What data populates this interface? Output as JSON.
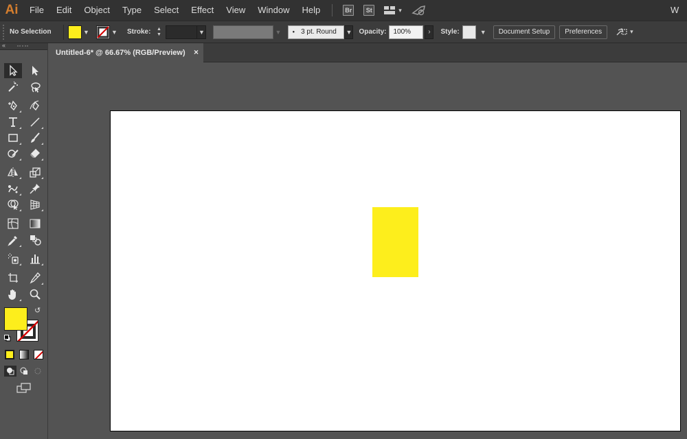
{
  "app": {
    "logo": "Ai",
    "workspace_label": "W"
  },
  "menu": [
    "File",
    "Edit",
    "Object",
    "Type",
    "Select",
    "Effect",
    "View",
    "Window",
    "Help"
  ],
  "app_buttons": [
    "Br",
    "St"
  ],
  "control_bar": {
    "selection_label": "No Selection",
    "stroke_label": "Stroke:",
    "stroke_weight": "",
    "brush_label": "3 pt. Round",
    "opacity_label": "Opacity:",
    "opacity_value": "100%",
    "style_label": "Style:",
    "document_setup": "Document Setup",
    "preferences": "Preferences"
  },
  "document": {
    "tab_title": "Untitled-6* @ 66.67% (RGB/Preview)",
    "close_glyph": "×"
  },
  "colors": {
    "fill": "#fdee1c",
    "rect_fill": "#fdee1c",
    "menu_bg": "#323232",
    "panel_bg": "#535353",
    "artboard": "#ffffff",
    "logo": "#d57e2e"
  },
  "tools": [
    [
      "selection-tool",
      "direct-selection-tool"
    ],
    [
      "magic-wand-tool",
      "lasso-tool"
    ],
    [
      "pen-tool",
      "curvature-tool"
    ],
    [
      "type-tool",
      "line-segment-tool"
    ],
    [
      "rectangle-tool",
      "paintbrush-tool"
    ],
    [
      "shaper-tool",
      "eraser-tool"
    ],
    [
      "reflect-tool",
      "scale-tool"
    ],
    [
      "puppet-warp-tool",
      "pin-tool"
    ],
    [
      "shape-builder-tool",
      "perspective-grid-tool"
    ],
    [
      "mesh-tool",
      "gradient-tool"
    ],
    [
      "eyedropper-tool",
      "blend-tool"
    ],
    [
      "symbol-sprayer-tool",
      "column-graph-tool"
    ],
    [
      "artboard-tool",
      "slice-tool"
    ],
    [
      "hand-tool",
      "zoom-tool"
    ]
  ],
  "artwork": {
    "shape": "rectangle"
  }
}
